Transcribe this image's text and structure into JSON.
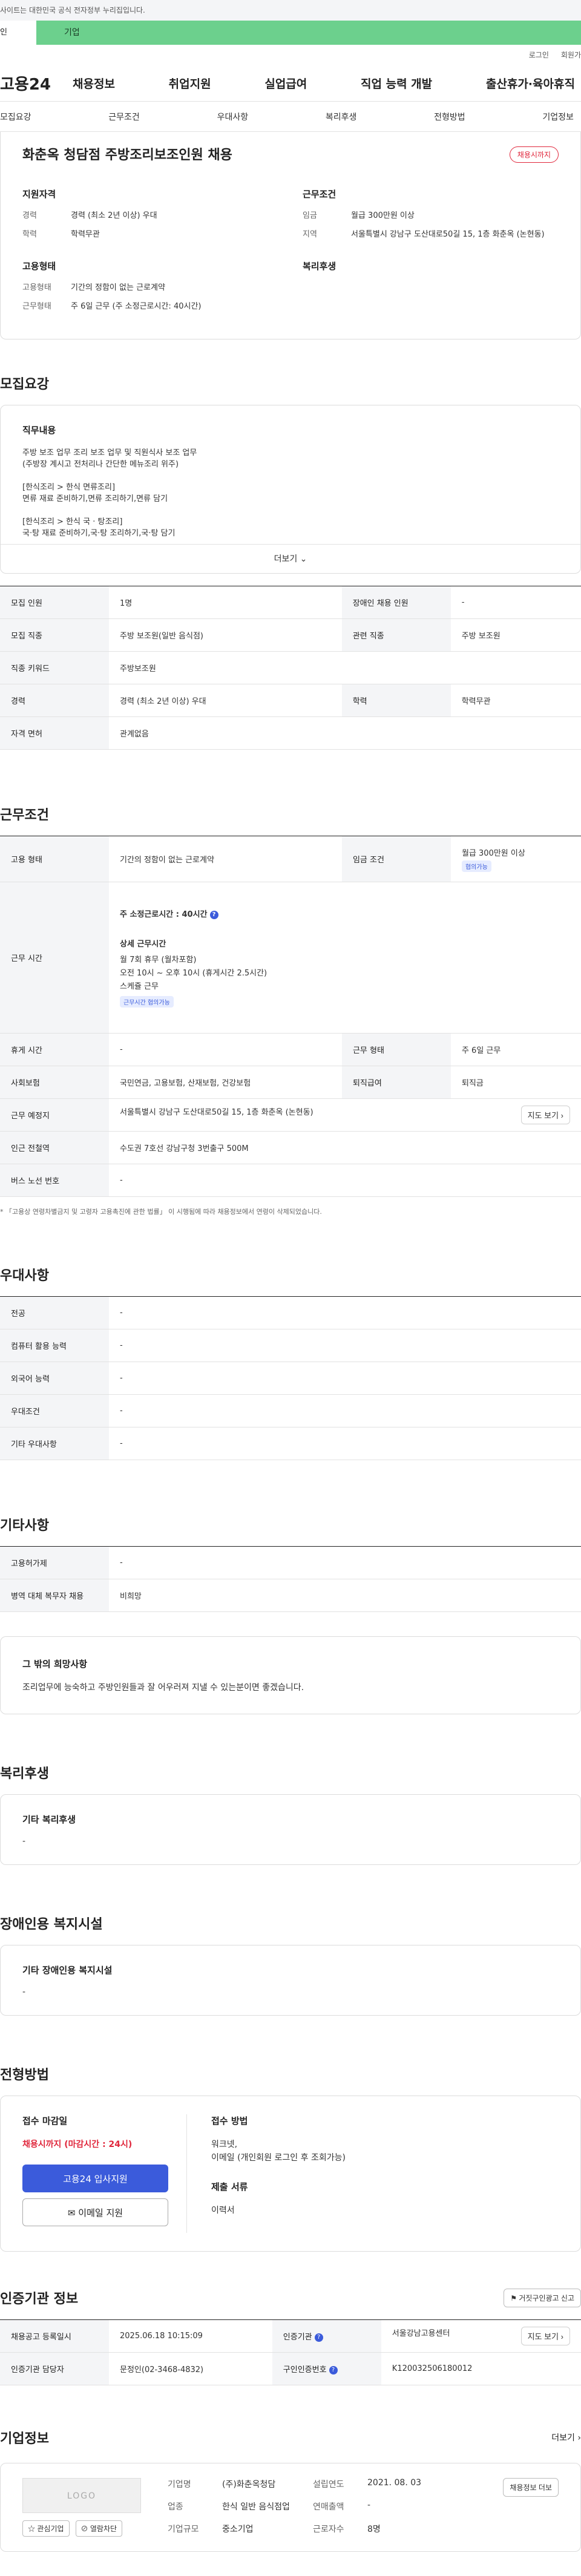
{
  "topbar": {
    "notice": "사이트는 대한민국 공식 전자정부 누리집입니다."
  },
  "tabs": {
    "individual": "인",
    "corporate": "기업"
  },
  "util": {
    "login": "로그인",
    "signup": "회원가"
  },
  "gnb": {
    "logo": "고용24",
    "menu": [
      "채용정보",
      "취업지원",
      "실업급여",
      "직업 능력 개발",
      "출산휴가·육아휴직"
    ]
  },
  "subnav": [
    "모집요강",
    "근무조건",
    "우대사항",
    "복리후생",
    "전형방법",
    "기업정보"
  ],
  "summary": {
    "title": "화춘옥 청담점 주방조리보조인원 채용",
    "status_badge": "채용시까지",
    "qual_head": "지원자격",
    "qual": [
      {
        "k": "경력",
        "v": "경력 (최소 2년 이상) 우대"
      },
      {
        "k": "학력",
        "v": "학력무관"
      }
    ],
    "cond_head": "근무조건",
    "cond": [
      {
        "k": "임금",
        "v": "월급 300만원 이상"
      },
      {
        "k": "지역",
        "v": "서울특별시 강남구 도산대로50길 15, 1층 화춘옥 (논현동)"
      }
    ],
    "emp_head": "고용형태",
    "emp": [
      {
        "k": "고용형태",
        "v": "기간의 정함이 없는 근로계약"
      },
      {
        "k": "근무형태",
        "v": "주 6일 근무 (주 소정근로시간: 40시간)"
      }
    ],
    "welfare_head": "복리후생"
  },
  "recruit": {
    "title": "모집요강",
    "duty_title": "직무내용",
    "duty_lines": [
      "주방 보조 업무 조리 보조 업무 및 직원식사 보조 업무",
      "(주방장 계시고 전처리나 간단한 메뉴조리 위주)",
      "",
      "[한식조리 > 한식 면류조리]",
      "면류 재료 준비하기,면류 조리하기,면류 담기",
      "",
      "[한식조리 > 한식 국 · 탕조리]",
      "국·탕 재료 준비하기,국·탕 조리하기,국·탕 담기"
    ],
    "more": "더보기",
    "rows": [
      {
        "k1": "모집 인원",
        "v1": "1명",
        "k2": "장애인 채용 인원",
        "v2": "-"
      },
      {
        "k1": "모집 직종",
        "v1": "주방 보조원(일반 음식점)",
        "k2": "관련 직종",
        "v2": "주방 보조원"
      },
      {
        "k1": "직종 키워드",
        "v1": "주방보조원",
        "k2": "",
        "v2": ""
      },
      {
        "k1": "경력",
        "v1": "경력 (최소 2년 이상) 우대",
        "k2": "학력",
        "v2": "학력무관"
      },
      {
        "k1": "자격 면허",
        "v1": "관계없음",
        "k2": "",
        "v2": ""
      }
    ]
  },
  "work": {
    "title": "근무조건",
    "emp_type_k": "고용 형태",
    "emp_type_v": "기간의 정함이 없는 근로계약",
    "wage_k": "임금 조건",
    "wage_v": "월급 300만원 이상",
    "wage_tag": "협의가능",
    "hours_k": "근무 시간",
    "hours_weekly": "주 소정근로시간 : 40시간",
    "hours_detail_title": "상세 근무시간",
    "hours_lines": [
      "월 7회 휴무 (월차포함)",
      "오전 10시 ~ 오후 10시 (휴게시간 2.5시간)",
      "스케쥴 근무"
    ],
    "hours_tag": "근무시간 협의가능",
    "rows": [
      {
        "k1": "휴게 시간",
        "v1": "-",
        "k2": "근무 형태",
        "v2": "주 6일 근무"
      },
      {
        "k1": "사회보험",
        "v1": "국민연금, 고용보험, 산재보험, 건강보험",
        "k2": "퇴직급여",
        "v2": "퇴직금"
      }
    ],
    "place_k": "근무 예정지",
    "place_v": "서울특별시 강남구 도산대로50길 15, 1층 화춘옥 (논현동)",
    "map_btn": "지도 보기",
    "subway_k": "인근 전철역",
    "subway_v": "수도권 7호선 강남구청 3번출구 500M",
    "bus_k": "버스 노선 번호",
    "bus_v": "-",
    "note": "* 「고용상 연령차별금지 및 고령자 고용촉진에 관한 법률」 이 시행됨에 따라 채용정보에서 연령이 삭제되었습니다."
  },
  "pref": {
    "title": "우대사항",
    "rows": [
      {
        "k": "전공",
        "v": "-"
      },
      {
        "k": "컴퓨터 활용 능력",
        "v": "-"
      },
      {
        "k": "외국어 능력",
        "v": "-"
      },
      {
        "k": "우대조건",
        "v": "-"
      },
      {
        "k": "기타 우대사항",
        "v": "-"
      }
    ]
  },
  "etc": {
    "title": "기타사항",
    "rows": [
      {
        "k": "고용허가제",
        "v": "-"
      },
      {
        "k": "병역 대체 복무자 채용",
        "v": "비희망"
      }
    ],
    "hope_title": "그 밖의 희망사항",
    "hope_text": "조리업무에 능숙하고 주방인원들과 잘 어우러져 지낼 수 있는분이면 좋겠습니다."
  },
  "welfare": {
    "title": "복리후생",
    "box_title": "기타 복리후생",
    "box_text": "-"
  },
  "disab": {
    "title": "장애인용 복지시설",
    "box_title": "기타 장애인용 복지시설",
    "box_text": "-"
  },
  "selection": {
    "title": "전형방법",
    "deadline_title": "접수 마감일",
    "deadline_text": "채용시까지 (마감시간 : 24시)",
    "btn_apply": "고용24 입사지원",
    "btn_email": "이메일 지원",
    "method_title": "접수 방법",
    "method_lines": [
      "워크넷,",
      "이메일 (개인회원 로그인 후 조회가능)"
    ],
    "docs_title": "제출 서류",
    "docs_text": "이력서"
  },
  "cert": {
    "title": "인증기관 정보",
    "report_btn": "거짓구인광고 신고",
    "rows": [
      {
        "k1": "채용공고 등록일시",
        "v1": "2025.06.18 10:15:09",
        "k2": "인증기관",
        "v2": "서울강남고용센터"
      },
      {
        "k1": "인증기관 담당자",
        "v1": "문정인(02-3468-4832)",
        "k2": "구인인증번호",
        "v2": "K120032506180012"
      }
    ],
    "map_btn": "지도 보기"
  },
  "corp": {
    "title": "기업정보",
    "more": "더보기",
    "logo": "LOGO",
    "btn_fav": "관심기업",
    "btn_block": "열람차단",
    "fields": [
      {
        "k": "기업명",
        "v": "(주)화춘옥청담"
      },
      {
        "k": "설립연도",
        "v": "2021. 08. 03"
      },
      {
        "k": "업종",
        "v": "한식 일반 음식점업"
      },
      {
        "k": "연매출액",
        "v": "-"
      },
      {
        "k": "기업규모",
        "v": "중소기업"
      },
      {
        "k": "근로자수",
        "v": "8명"
      }
    ],
    "hiring_btn": "채용정보 더보"
  }
}
